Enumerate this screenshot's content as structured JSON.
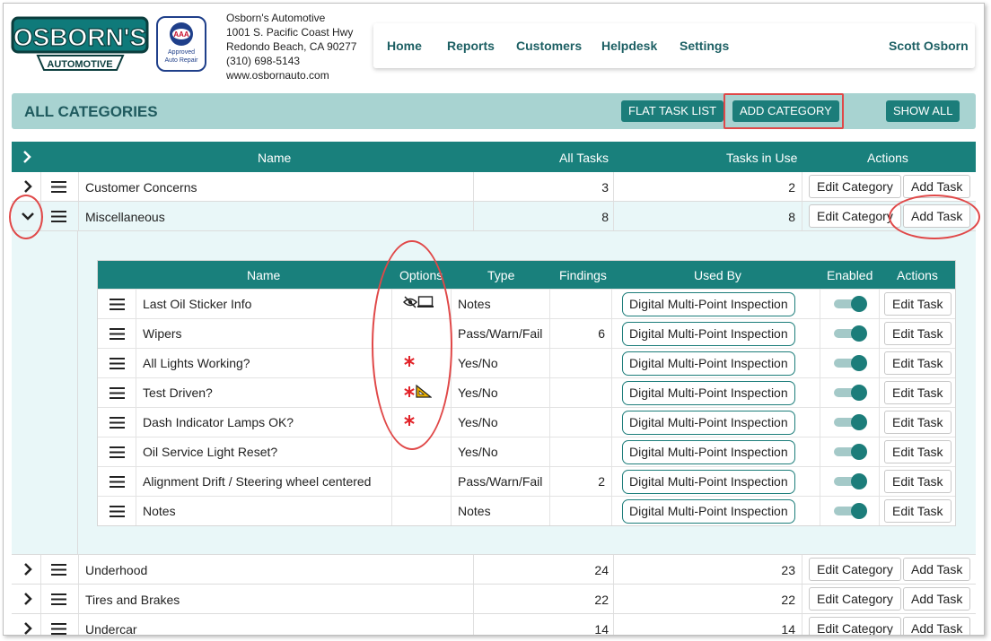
{
  "header": {
    "logo_text": "OSBORN'S",
    "logo_subtext": "AUTOMOTIVE",
    "aaa_badge": {
      "line1": "Approved",
      "line2": "Auto Repair",
      "mark": "AAA"
    },
    "address": [
      "Osborn's Automotive",
      "1001 S. Pacific Coast Hwy",
      "Redondo Beach, CA 90277",
      "(310) 698-5143",
      "www.osbornauto.com"
    ],
    "nav": [
      "Home",
      "Reports",
      "Customers",
      "Helpdesk",
      "Settings"
    ],
    "user": "Scott Osborn"
  },
  "toolbar": {
    "title": "ALL CATEGORIES",
    "flat_task_list": "FLAT TASK LIST",
    "add_category": "ADD CATEGORY",
    "show_all": "SHOW ALL"
  },
  "main_table": {
    "headers": {
      "name": "Name",
      "all_tasks": "All Tasks",
      "tasks_in_use": "Tasks in Use",
      "actions": "Actions"
    },
    "edit_category_label": "Edit Category",
    "add_task_label": "Add Task",
    "rows": [
      {
        "name": "Customer Concerns",
        "all_tasks": "3",
        "tasks_in_use": "2"
      },
      {
        "name": "Miscellaneous",
        "all_tasks": "8",
        "tasks_in_use": "8"
      },
      {
        "name": "Underhood",
        "all_tasks": "24",
        "tasks_in_use": "23"
      },
      {
        "name": "Tires and Brakes",
        "all_tasks": "22",
        "tasks_in_use": "22"
      },
      {
        "name": "Undercar",
        "all_tasks": "14",
        "tasks_in_use": "14"
      }
    ]
  },
  "sub_table": {
    "headers": {
      "name": "Name",
      "options": "Options",
      "type": "Type",
      "findings": "Findings",
      "used_by": "Used By",
      "enabled": "Enabled",
      "actions": "Actions"
    },
    "edit_task_label": "Edit Task",
    "rows": [
      {
        "name": "Last Oil Sticker Info",
        "options": [
          "hidden-eye-icon",
          "tablet-icon"
        ],
        "type": "Notes",
        "findings": "",
        "used_by": "Digital Multi-Point Inspection",
        "enabled": true
      },
      {
        "name": "Wipers",
        "options": [],
        "type": "Pass/Warn/Fail",
        "findings": "6",
        "used_by": "Digital Multi-Point Inspection",
        "enabled": true
      },
      {
        "name": "All Lights Working?",
        "options": [
          "required-asterisk-icon"
        ],
        "type": "Yes/No",
        "findings": "",
        "used_by": "Digital Multi-Point Inspection",
        "enabled": true
      },
      {
        "name": "Test Driven?",
        "options": [
          "required-asterisk-icon",
          "triangle-ruler-icon"
        ],
        "type": "Yes/No",
        "findings": "",
        "used_by": "Digital Multi-Point Inspection",
        "enabled": true
      },
      {
        "name": "Dash Indicator Lamps OK?",
        "options": [
          "required-asterisk-icon"
        ],
        "type": "Yes/No",
        "findings": "",
        "used_by": "Digital Multi-Point Inspection",
        "enabled": true
      },
      {
        "name": "Oil Service Light Reset?",
        "options": [],
        "type": "Yes/No",
        "findings": "",
        "used_by": "Digital Multi-Point Inspection",
        "enabled": true
      },
      {
        "name": "Alignment Drift / Steering wheel centered",
        "options": [],
        "type": "Pass/Warn/Fail",
        "findings": "2",
        "used_by": "Digital Multi-Point Inspection",
        "enabled": true
      },
      {
        "name": "Notes",
        "options": [],
        "type": "Notes",
        "findings": "",
        "used_by": "Digital Multi-Point Inspection",
        "enabled": true
      }
    ]
  },
  "colors": {
    "teal": "#19807c",
    "light_teal": "#a8d3d1",
    "expanded_bg": "#e9f7f8",
    "annotation_red": "#e04848",
    "required_red": "#e2242a"
  }
}
